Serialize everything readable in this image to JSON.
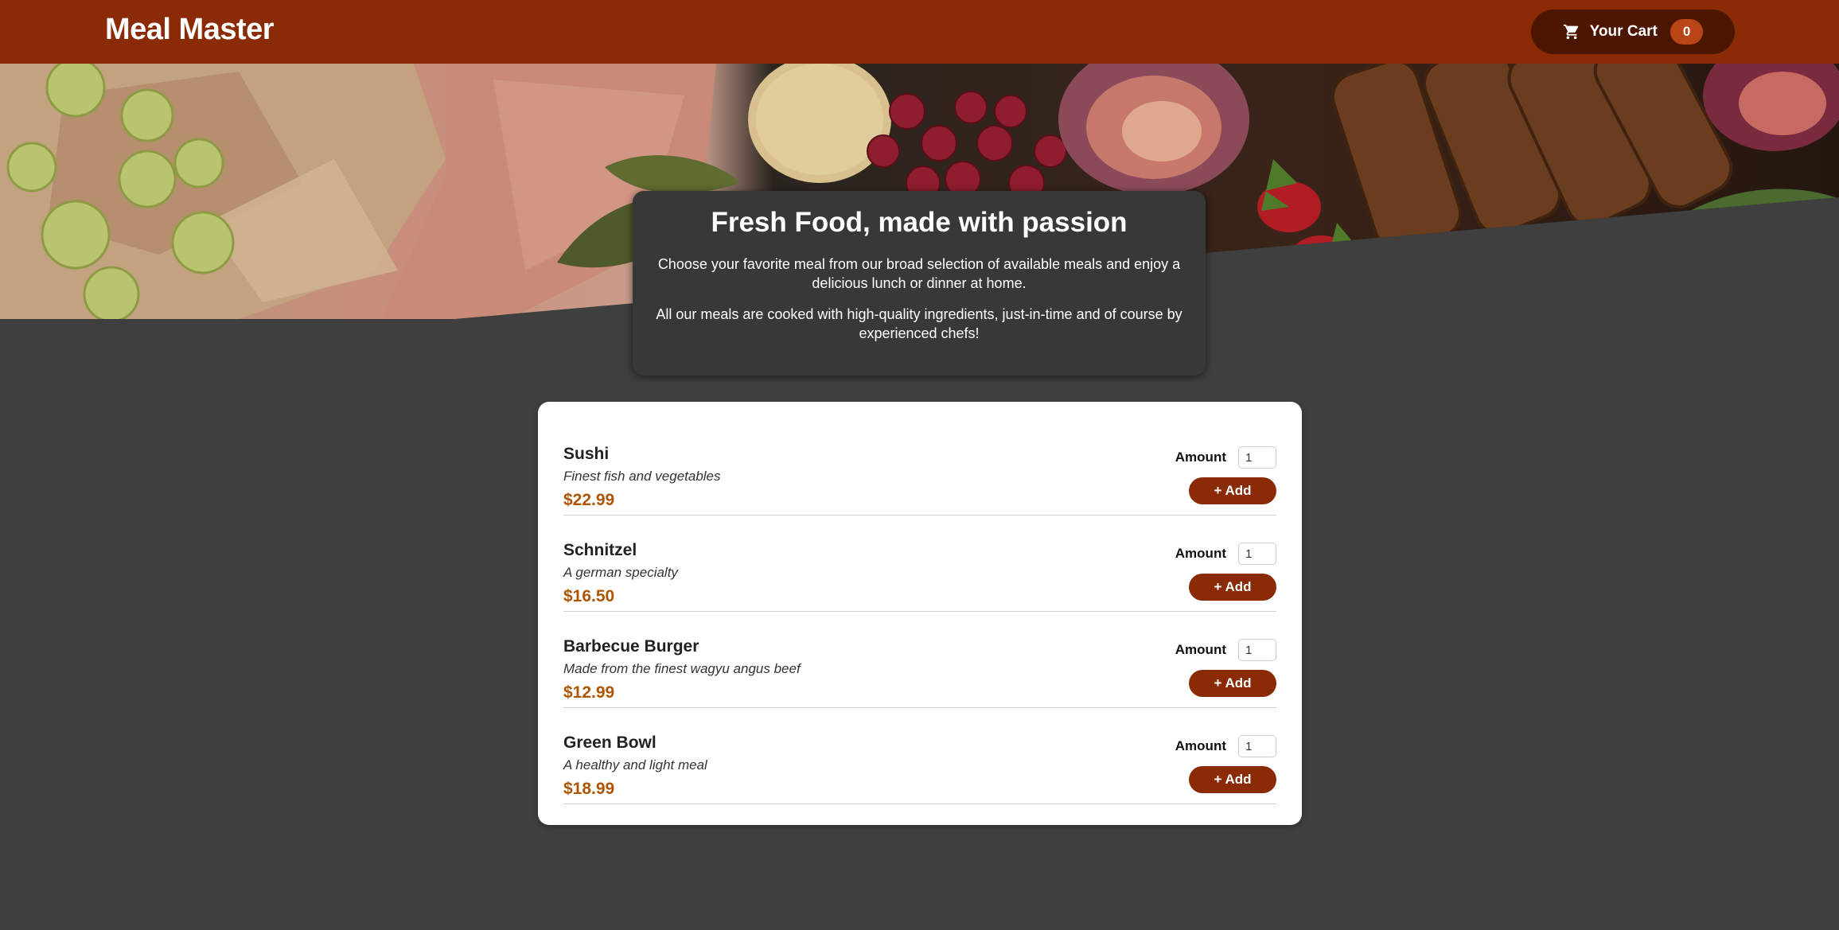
{
  "header": {
    "title": "Meal Master",
    "cart": {
      "label": "Your Cart",
      "count": "0",
      "icon": "cart-icon"
    }
  },
  "hero": {
    "image_alt": "A table full of delicious food"
  },
  "summary": {
    "title": "Fresh Food, made with passion",
    "paragraph_1": "Choose your favorite meal from our broad selection of available meals and enjoy a delicious lunch or dinner at home.",
    "paragraph_2": "All our meals are cooked with high-quality ingredients, just-in-time and of course by experienced chefs!"
  },
  "meals": [
    {
      "name": "Sushi",
      "description": "Finest fish and vegetables",
      "price": "$22.99",
      "amount_label": "Amount",
      "amount": "1",
      "add_label": "+ Add"
    },
    {
      "name": "Schnitzel",
      "description": "A german specialty",
      "price": "$16.50",
      "amount_label": "Amount",
      "amount": "1",
      "add_label": "+ Add"
    },
    {
      "name": "Barbecue Burger",
      "description": "Made from the finest wagyu angus beef",
      "price": "$12.99",
      "amount_label": "Amount",
      "amount": "1",
      "add_label": "+ Add"
    },
    {
      "name": "Green Bowl",
      "description": "A healthy and light meal",
      "price": "$18.99",
      "amount_label": "Amount",
      "amount": "1",
      "add_label": "+ Add"
    }
  ],
  "colors": {
    "header": "#8a2b06",
    "cart_button": "#4d1601",
    "badge": "#b94517",
    "page_background": "#3f3f3f",
    "price": "#ad5502"
  }
}
